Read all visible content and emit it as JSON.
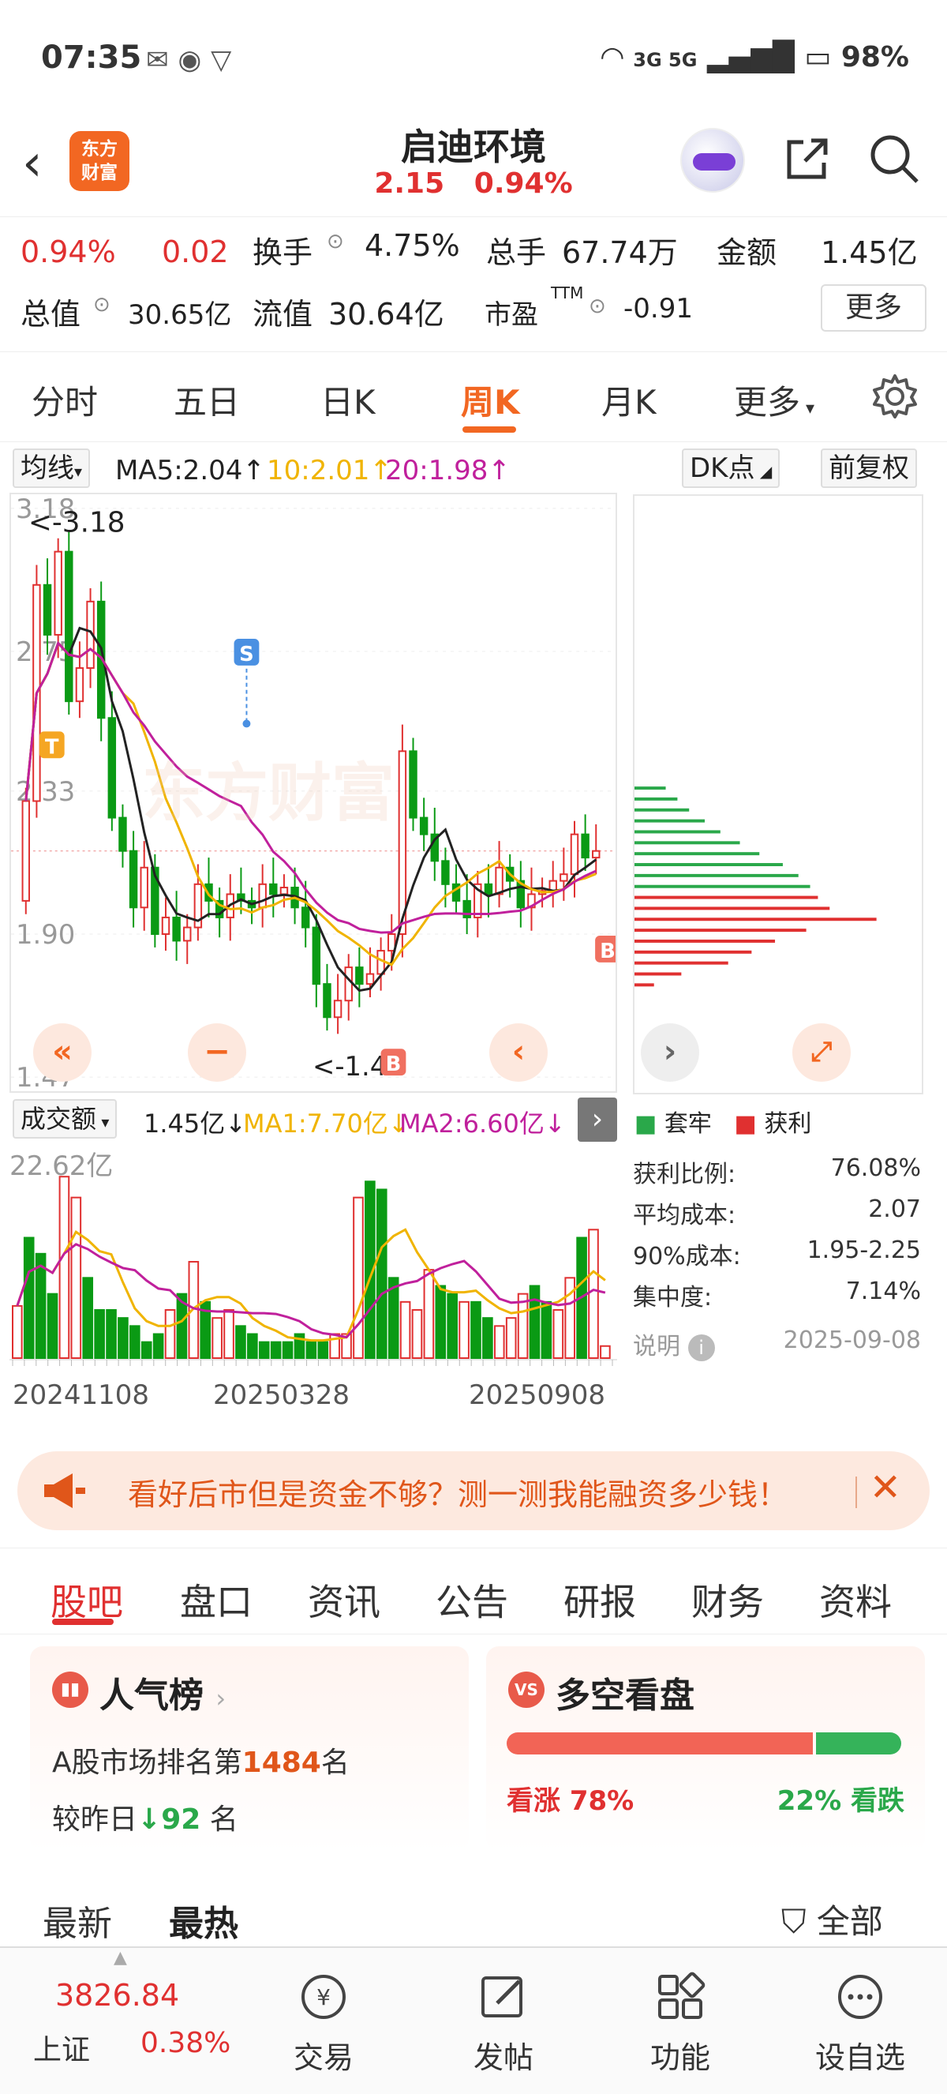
{
  "status_bar": {
    "time": "07:35",
    "signal": "3G 5G",
    "battery": "98%"
  },
  "header": {
    "logo_line1": "东方",
    "logo_line2": "财富",
    "stock_name": "启迪环境",
    "price": "2.15",
    "change_pct": "0.94%"
  },
  "quote": {
    "pct": "0.94%",
    "chg": "0.02",
    "turnover_label": "换手",
    "turnover": "4.75%",
    "volume_label": "总手",
    "volume": "67.74万",
    "amount_label": "金额",
    "amount": "1.45亿",
    "total_value_label": "总值",
    "total_value": "30.65亿",
    "float_value_label": "流值",
    "float_value": "30.64亿",
    "pe_label": "市盈",
    "pe_sup": "TTM",
    "pe": "-0.91",
    "more": "更多"
  },
  "period_tabs": [
    "分时",
    "五日",
    "日K",
    "周K",
    "月K",
    "更多"
  ],
  "ma": {
    "selector": "均线",
    "ma5": "MA5:2.04↑",
    "ma10": "10:2.01↑",
    "ma20": "20:1.98↑",
    "dk": "DK点",
    "adjust": "前复权",
    "colors": {
      "ma5": "#222222",
      "ma10": "#f0b400",
      "ma20": "#c0209c",
      "up": "#e03030",
      "down": "#0a9a14"
    }
  },
  "kline": {
    "y_ticks": [
      "3.18",
      "2.75",
      "2.33",
      "1.90",
      "1.47"
    ],
    "high_marker": "<-3.18",
    "low_marker": "<-1.47",
    "last_price": 2.15,
    "signals": [
      "S",
      "T",
      "B",
      "B"
    ]
  },
  "volume": {
    "selector": "成交额",
    "value": "1.45亿↓",
    "ma1": "MA1:7.70亿↓",
    "ma2": "MA2:6.60亿↓",
    "max_label": "22.62亿",
    "dates": [
      "20241108",
      "20250328",
      "20250908"
    ]
  },
  "chips": {
    "legend_trapped": "套牢",
    "legend_profit": "获利",
    "rows": [
      {
        "label": "获利比例:",
        "value": "76.08%"
      },
      {
        "label": "平均成本:",
        "value": "2.07"
      },
      {
        "label": "90%成本:",
        "value": "1.95-2.25"
      },
      {
        "label": "集中度:",
        "value": "7.14%"
      }
    ],
    "note": "说明",
    "date": "2025-09-08"
  },
  "banner": {
    "text": "看好后市但是资金不够？测一测我能融资多少钱！"
  },
  "section_tabs": [
    "股吧",
    "盘口",
    "资讯",
    "公告",
    "研报",
    "财务",
    "资料"
  ],
  "popularity": {
    "title": "人气榜",
    "rank_prefix": "A股市场排名第",
    "rank": "1484",
    "rank_suffix": "名",
    "change_prefix": "较昨日",
    "change": "92",
    "change_suffix": "名"
  },
  "sentiment": {
    "title": "多空看盘",
    "bull_label": "看涨",
    "bull_pct": "78%",
    "bear_pct": "22%",
    "bear_label": "看跌",
    "bull_share": 0.78
  },
  "post_tabs": {
    "latest": "最新",
    "hot": "最热",
    "filter": "全部"
  },
  "bottom_nav": {
    "index_value": "3826.84",
    "index_name": "上证",
    "index_pct": "0.38%",
    "items": [
      "交易",
      "发帖",
      "功能",
      "设自选"
    ]
  }
}
